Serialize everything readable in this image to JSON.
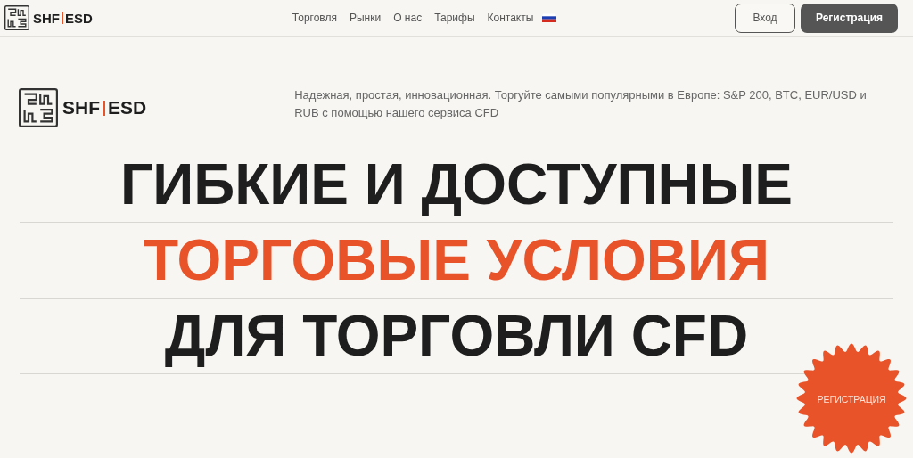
{
  "header": {
    "brand": {
      "left": "SHF",
      "right": "ESD"
    },
    "nav": [
      {
        "label": "Торговля"
      },
      {
        "label": "Рынки"
      },
      {
        "label": "О нас"
      },
      {
        "label": "Тарифы"
      },
      {
        "label": "Контакты"
      }
    ],
    "login": "Вход",
    "register": "Регистрация"
  },
  "hero": {
    "brand": {
      "left": "SHF",
      "right": "ESD"
    },
    "tagline": "Надежная, простая, инновационная. Торгуйте самыми популярными в Европе: S&P 200, BTC, EUR/USD и RUB с помощью нашего сервиса CFD",
    "headline": [
      {
        "text": "ГИБКИЕ И ДОСТУПНЫЕ",
        "accent": false
      },
      {
        "text": "ТОРГОВЫЕ УСЛОВИЯ",
        "accent": true
      },
      {
        "text": "ДЛЯ ТОРГОВЛИ CFD",
        "accent": false
      }
    ],
    "badge": "РЕГИСТРАЦИЯ"
  }
}
